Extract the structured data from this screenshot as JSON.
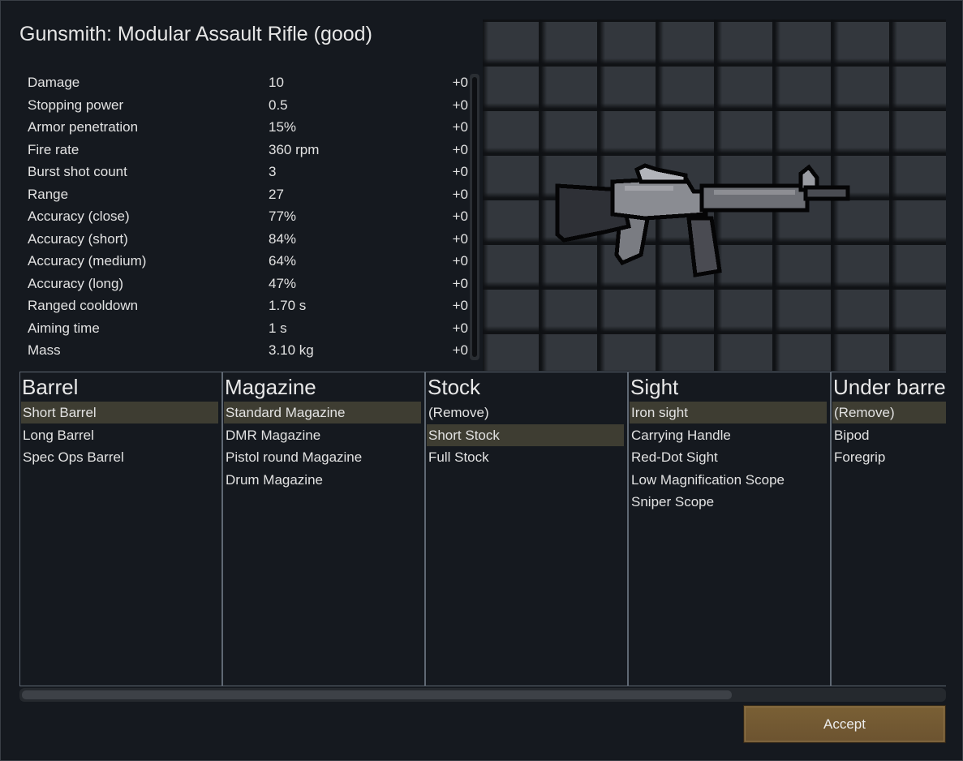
{
  "title": "Gunsmith: Modular Assault Rifle (good)",
  "stats": [
    {
      "name": "Damage",
      "value": "10",
      "delta": "+0"
    },
    {
      "name": "Stopping power",
      "value": "0.5",
      "delta": "+0"
    },
    {
      "name": "Armor penetration",
      "value": "15%",
      "delta": "+0"
    },
    {
      "name": "Fire rate",
      "value": "360 rpm",
      "delta": "+0"
    },
    {
      "name": "Burst shot count",
      "value": "3",
      "delta": "+0"
    },
    {
      "name": "Range",
      "value": "27",
      "delta": "+0"
    },
    {
      "name": "Accuracy (close)",
      "value": "77%",
      "delta": "+0"
    },
    {
      "name": "Accuracy (short)",
      "value": "84%",
      "delta": "+0"
    },
    {
      "name": "Accuracy (medium)",
      "value": "64%",
      "delta": "+0"
    },
    {
      "name": "Accuracy (long)",
      "value": "47%",
      "delta": "+0"
    },
    {
      "name": "Ranged cooldown",
      "value": "1.70 s",
      "delta": "+0"
    },
    {
      "name": "Aiming time",
      "value": "1 s",
      "delta": "+0"
    },
    {
      "name": "Mass",
      "value": "3.10 kg",
      "delta": "+0"
    }
  ],
  "preview": {
    "icon": "assault-rifle-sprite",
    "background": "dark-grid"
  },
  "slots": [
    {
      "title": "Barrel",
      "options": [
        "Short Barrel",
        "Long Barrel",
        "Spec Ops Barrel"
      ],
      "selected": 0
    },
    {
      "title": "Magazine",
      "options": [
        "Standard Magazine",
        "DMR Magazine",
        "Pistol round Magazine",
        "Drum Magazine"
      ],
      "selected": 0
    },
    {
      "title": "Stock",
      "options": [
        "(Remove)",
        "Short Stock",
        "Full Stock"
      ],
      "selected": 1
    },
    {
      "title": "Sight",
      "options": [
        "Iron sight",
        "Carrying Handle",
        "Red-Dot Sight",
        "Low Magnification Scope",
        "Sniper Scope"
      ],
      "selected": 0
    },
    {
      "title": "Under barrel",
      "options": [
        "(Remove)",
        "Bipod",
        "Foregrip"
      ],
      "selected": 0
    }
  ],
  "horizontal_scroll": {
    "visible_fraction": 0.77
  },
  "accept_label": "Accept",
  "colors": {
    "background": "#15191f",
    "selected_row": "#3e3d32",
    "accept_button": "#735a33",
    "slot_border": "#5f6873"
  }
}
